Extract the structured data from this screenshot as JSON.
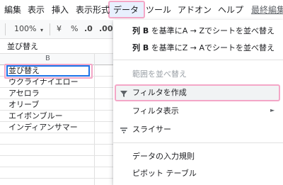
{
  "menubar": {
    "items": [
      "編集",
      "表示",
      "挿入",
      "表示形式",
      "データ",
      "ツール",
      "アドオン",
      "ヘルプ",
      "最終編集"
    ]
  },
  "toolbar": {
    "zoom": "100%",
    "zoom_caret": "▾",
    "currency": "¥",
    "percent": "%",
    "decimal_decrease": ".0",
    "decimal_increase": ".00"
  },
  "formula_bar": {
    "value": "並び替え"
  },
  "sheet": {
    "column_header": "B",
    "rows": [
      "並び替え",
      "ウクライナイエロー",
      "アセロラ",
      "オリーブ",
      "エイボンブルー",
      "インディアンサマー"
    ]
  },
  "data_menu": {
    "sort_asc_prefix": "列 B",
    "sort_asc_rest": " を基準にA → Zでシートを並べ替え",
    "sort_desc_prefix": "列 B",
    "sort_desc_rest": " を基準にZ → Aでシートを並べ替え",
    "sort_range": "範囲を並べ替え",
    "create_filter": "フィルタを作成",
    "filter_views": "フィルタ表示",
    "submenu_arrow": "►",
    "slicer": "スライサー",
    "data_validation": "データの入力規則",
    "pivot_table": "ピボット テーブル"
  },
  "colors": {
    "highlight_pink": "#f4a7c7",
    "selection_blue": "#1a73e8",
    "active_menu_bg": "#e8f0fe"
  },
  "icons": [
    "filter-icon",
    "slicer-icon",
    "submenu-arrow-icon"
  ]
}
